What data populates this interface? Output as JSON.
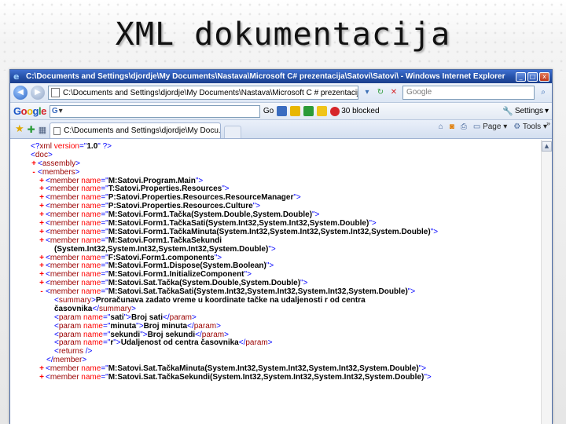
{
  "slide": {
    "title": "XML dokumentacija"
  },
  "browser": {
    "window_title": "C:\\Documents and Settings\\djordje\\My Documents\\Nastava\\Microsoft C# prezentacija\\Satovi\\Satovi\\ - Windows Internet Explorer",
    "controls": {
      "minimize": "_",
      "maximize": "□",
      "close": "x"
    },
    "address": "C:\\Documents and Settings\\djordje\\My Documents\\Nastava\\Microsoft C # prezentacija",
    "search_placeholder": "Google",
    "google_toolbar": {
      "logo": "Google",
      "search_prefix": "G",
      "go_label": "Go",
      "blocked_label": "30 blocked",
      "settings_label": "Settings"
    },
    "tab": {
      "title": "C:\\Documents and Settings\\djordje\\My Docu..."
    },
    "tools": {
      "page_label": "Page",
      "tools_label": "Tools",
      "more": "»"
    }
  },
  "xml_lines": [
    {
      "pm": "",
      "indent": 0,
      "parts": [
        [
          "br",
          "<?"
        ],
        [
          "tag",
          "xml"
        ],
        [
          "attr",
          " version"
        ],
        [
          "br",
          "=\""
        ],
        [
          "val",
          "1.0"
        ],
        [
          "br",
          "\" ?>"
        ]
      ]
    },
    {
      "pm": "",
      "indent": 0,
      "parts": [
        [
          "br",
          "<"
        ],
        [
          "tag",
          "doc"
        ],
        [
          "br",
          ">"
        ]
      ]
    },
    {
      "pm": "+",
      "indent": 1,
      "parts": [
        [
          "br",
          "<"
        ],
        [
          "tag",
          "assembly"
        ],
        [
          "br",
          ">"
        ]
      ]
    },
    {
      "pm": "-",
      "indent": 1,
      "parts": [
        [
          "br",
          "<"
        ],
        [
          "tag",
          "members"
        ],
        [
          "br",
          ">"
        ]
      ]
    },
    {
      "pm": "+",
      "indent": 2,
      "parts": [
        [
          "br",
          "<"
        ],
        [
          "tag",
          "member"
        ],
        [
          "attr",
          " name"
        ],
        [
          "br",
          "=\""
        ],
        [
          "val",
          "M:Satovi.Program.Main"
        ],
        [
          "br",
          "\">"
        ]
      ]
    },
    {
      "pm": "+",
      "indent": 2,
      "parts": [
        [
          "br",
          "<"
        ],
        [
          "tag",
          "member"
        ],
        [
          "attr",
          " name"
        ],
        [
          "br",
          "=\""
        ],
        [
          "val",
          "T:Satovi.Properties.Resources"
        ],
        [
          "br",
          "\">"
        ]
      ]
    },
    {
      "pm": "+",
      "indent": 2,
      "parts": [
        [
          "br",
          "<"
        ],
        [
          "tag",
          "member"
        ],
        [
          "attr",
          " name"
        ],
        [
          "br",
          "=\""
        ],
        [
          "val",
          "P:Satovi.Properties.Resources.ResourceManager"
        ],
        [
          "br",
          "\">"
        ]
      ]
    },
    {
      "pm": "+",
      "indent": 2,
      "parts": [
        [
          "br",
          "<"
        ],
        [
          "tag",
          "member"
        ],
        [
          "attr",
          " name"
        ],
        [
          "br",
          "=\""
        ],
        [
          "val",
          "P:Satovi.Properties.Resources.Culture"
        ],
        [
          "br",
          "\">"
        ]
      ]
    },
    {
      "pm": "+",
      "indent": 2,
      "parts": [
        [
          "br",
          "<"
        ],
        [
          "tag",
          "member"
        ],
        [
          "attr",
          " name"
        ],
        [
          "br",
          "=\""
        ],
        [
          "val",
          "M:Satovi.Form1.Tačka(System.Double,System.Double)"
        ],
        [
          "br",
          "\">"
        ]
      ]
    },
    {
      "pm": "+",
      "indent": 2,
      "parts": [
        [
          "br",
          "<"
        ],
        [
          "tag",
          "member"
        ],
        [
          "attr",
          " name"
        ],
        [
          "br",
          "=\""
        ],
        [
          "val",
          "M:Satovi.Form1.TačkaSati(System.Int32,System.Int32,System.Double)"
        ],
        [
          "br",
          "\">"
        ]
      ]
    },
    {
      "pm": "+",
      "indent": 2,
      "parts": [
        [
          "br",
          "<"
        ],
        [
          "tag",
          "member"
        ],
        [
          "attr",
          " name"
        ],
        [
          "br",
          "=\""
        ],
        [
          "val",
          "M:Satovi.Form1.TačkaMinuta(System.Int32,System.Int32,System.Int32,System.Double)"
        ],
        [
          "br",
          "\">"
        ]
      ]
    },
    {
      "pm": "+",
      "indent": 2,
      "parts": [
        [
          "br",
          "<"
        ],
        [
          "tag",
          "member"
        ],
        [
          "attr",
          " name"
        ],
        [
          "br",
          "=\""
        ],
        [
          "val",
          "M:Satovi.Form1.TačkaSekundi"
        ],
        [
          "br",
          ""
        ]
      ]
    },
    {
      "pm": "",
      "indent": 3,
      "parts": [
        [
          "val",
          "(System.Int32,System.Int32,System.Int32,System.Double)"
        ],
        [
          "br",
          "\">"
        ]
      ]
    },
    {
      "pm": "+",
      "indent": 2,
      "parts": [
        [
          "br",
          "<"
        ],
        [
          "tag",
          "member"
        ],
        [
          "attr",
          " name"
        ],
        [
          "br",
          "=\""
        ],
        [
          "val",
          "F:Satovi.Form1.components"
        ],
        [
          "br",
          "\">"
        ]
      ]
    },
    {
      "pm": "+",
      "indent": 2,
      "parts": [
        [
          "br",
          "<"
        ],
        [
          "tag",
          "member"
        ],
        [
          "attr",
          " name"
        ],
        [
          "br",
          "=\""
        ],
        [
          "val",
          "M:Satovi.Form1.Dispose(System.Boolean)"
        ],
        [
          "br",
          "\">"
        ]
      ]
    },
    {
      "pm": "+",
      "indent": 2,
      "parts": [
        [
          "br",
          "<"
        ],
        [
          "tag",
          "member"
        ],
        [
          "attr",
          " name"
        ],
        [
          "br",
          "=\""
        ],
        [
          "val",
          "M:Satovi.Form1.InitializeComponent"
        ],
        [
          "br",
          "\">"
        ]
      ]
    },
    {
      "pm": "+",
      "indent": 2,
      "parts": [
        [
          "br",
          "<"
        ],
        [
          "tag",
          "member"
        ],
        [
          "attr",
          " name"
        ],
        [
          "br",
          "=\""
        ],
        [
          "val",
          "M:Satovi.Sat.Tačka(System.Double,System.Double)"
        ],
        [
          "br",
          "\">"
        ]
      ]
    },
    {
      "pm": "-",
      "indent": 2,
      "parts": [
        [
          "br",
          "<"
        ],
        [
          "tag",
          "member"
        ],
        [
          "attr",
          " name"
        ],
        [
          "br",
          "=\""
        ],
        [
          "val",
          "M:Satovi.Sat.TačkaSati(System.Int32,System.Int32,System.Int32,System.Double)"
        ],
        [
          "br",
          "\">"
        ]
      ]
    },
    {
      "pm": "",
      "indent": 3,
      "parts": [
        [
          "br",
          "<"
        ],
        [
          "tag",
          "summary"
        ],
        [
          "br",
          ">"
        ],
        [
          "txt",
          "Proračunava zadato vreme u koordinate tačke na udaljenosti r od centra"
        ]
      ]
    },
    {
      "pm": "",
      "indent": 3,
      "parts": [
        [
          "txt",
          "časovnika"
        ],
        [
          "br",
          "</"
        ],
        [
          "tag",
          "summary"
        ],
        [
          "br",
          ">"
        ]
      ]
    },
    {
      "pm": "",
      "indent": 3,
      "parts": [
        [
          "br",
          "<"
        ],
        [
          "tag",
          "param"
        ],
        [
          "attr",
          " name"
        ],
        [
          "br",
          "=\""
        ],
        [
          "val",
          "sati"
        ],
        [
          "br",
          "\">"
        ],
        [
          "txt",
          "Broj sati"
        ],
        [
          "br",
          "</"
        ],
        [
          "tag",
          "param"
        ],
        [
          "br",
          ">"
        ]
      ]
    },
    {
      "pm": "",
      "indent": 3,
      "parts": [
        [
          "br",
          "<"
        ],
        [
          "tag",
          "param"
        ],
        [
          "attr",
          " name"
        ],
        [
          "br",
          "=\""
        ],
        [
          "val",
          "minuta"
        ],
        [
          "br",
          "\">"
        ],
        [
          "txt",
          "Broj minuta"
        ],
        [
          "br",
          "</"
        ],
        [
          "tag",
          "param"
        ],
        [
          "br",
          ">"
        ]
      ]
    },
    {
      "pm": "",
      "indent": 3,
      "parts": [
        [
          "br",
          "<"
        ],
        [
          "tag",
          "param"
        ],
        [
          "attr",
          " name"
        ],
        [
          "br",
          "=\""
        ],
        [
          "val",
          "sekundi"
        ],
        [
          "br",
          "\">"
        ],
        [
          "txt",
          "Broj sekundi"
        ],
        [
          "br",
          "</"
        ],
        [
          "tag",
          "param"
        ],
        [
          "br",
          ">"
        ]
      ]
    },
    {
      "pm": "",
      "indent": 3,
      "parts": [
        [
          "br",
          "<"
        ],
        [
          "tag",
          "param"
        ],
        [
          "attr",
          " name"
        ],
        [
          "br",
          "=\""
        ],
        [
          "val",
          "r"
        ],
        [
          "br",
          "\">"
        ],
        [
          "txt",
          "Udaljenost od centra časovnika"
        ],
        [
          "br",
          "</"
        ],
        [
          "tag",
          "param"
        ],
        [
          "br",
          ">"
        ]
      ]
    },
    {
      "pm": "",
      "indent": 3,
      "parts": [
        [
          "br",
          "<"
        ],
        [
          "tag",
          "returns"
        ],
        [
          "br",
          " />"
        ]
      ]
    },
    {
      "pm": "",
      "indent": 2,
      "parts": [
        [
          "br",
          "</"
        ],
        [
          "tag",
          "member"
        ],
        [
          "br",
          ">"
        ]
      ]
    },
    {
      "pm": "+",
      "indent": 2,
      "parts": [
        [
          "br",
          "<"
        ],
        [
          "tag",
          "member"
        ],
        [
          "attr",
          " name"
        ],
        [
          "br",
          "=\""
        ],
        [
          "val",
          "M:Satovi.Sat.TačkaMinuta(System.Int32,System.Int32,System.Int32,System.Double)"
        ],
        [
          "br",
          "\">"
        ]
      ]
    },
    {
      "pm": "+",
      "indent": 2,
      "parts": [
        [
          "br",
          "<"
        ],
        [
          "tag",
          "member"
        ],
        [
          "attr",
          " name"
        ],
        [
          "br",
          "=\""
        ],
        [
          "val",
          "M:Satovi.Sat.TačkaSekundi(System.Int32,System.Int32,System.Int32,System.Double)"
        ],
        [
          "br",
          "\">"
        ]
      ]
    }
  ]
}
